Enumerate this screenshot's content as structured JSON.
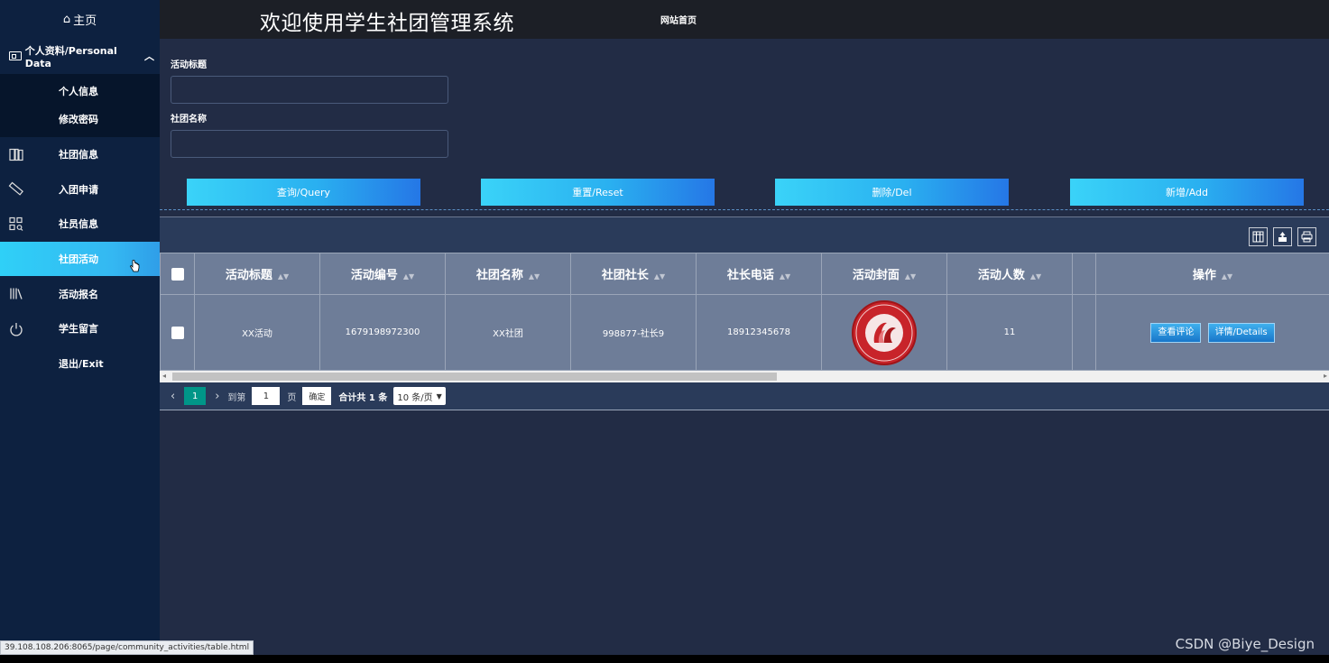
{
  "sidebar": {
    "home": "主页",
    "group_title": "个人资料/Personal Data",
    "sub_items": [
      "个人信息",
      "修改密码"
    ],
    "items": [
      {
        "label": "社团信息",
        "icon": "book-icon"
      },
      {
        "label": "入团申请",
        "icon": "ruler-icon"
      },
      {
        "label": "社员信息",
        "icon": "grid-search-icon"
      },
      {
        "label": "社团活动",
        "icon": "",
        "active": true
      },
      {
        "label": "活动报名",
        "icon": "library-icon"
      },
      {
        "label": "学生留言",
        "icon": "power-icon"
      },
      {
        "label": "退出/Exit",
        "icon": ""
      }
    ]
  },
  "header": {
    "title": "欢迎使用学生社团管理系统",
    "site_link": "网站首页"
  },
  "search": {
    "field1_label": "活动标题",
    "field1_value": "",
    "field2_label": "社团名称",
    "field2_value": ""
  },
  "buttons": {
    "query": "查询/Query",
    "reset": "重置/Reset",
    "delete": "删除/Del",
    "add": "新增/Add"
  },
  "table": {
    "headers": [
      "活动标题",
      "活动编号",
      "社团名称",
      "社团社长",
      "社长电话",
      "活动封面",
      "活动人数",
      "",
      "操作"
    ],
    "rows": [
      {
        "title": "XX活动",
        "id": "1679198972300",
        "club": "XX社团",
        "leader": "998877-社长9",
        "phone": "18912345678",
        "cover_text": "Union of Association",
        "count": "11",
        "actions": [
          "查看评论",
          "详情/Details"
        ]
      }
    ]
  },
  "pager": {
    "current": "1",
    "goto_label": "到第",
    "goto_value": "1",
    "page_unit": "页",
    "confirm": "确定",
    "total": "合计共 1 条",
    "per_page": "10 条/页"
  },
  "status_url": "39.108.108.206:8065/page/community_activities/table.html",
  "watermark": "CSDN @Biye_Design",
  "colors": {
    "sidebar_bg": "#0d2140",
    "active_item": "#34b8f2",
    "main_bg": "#222c45",
    "button_gradient_start": "#3ad3f8",
    "button_gradient_end": "#2577e6",
    "pager_active": "#009688"
  }
}
